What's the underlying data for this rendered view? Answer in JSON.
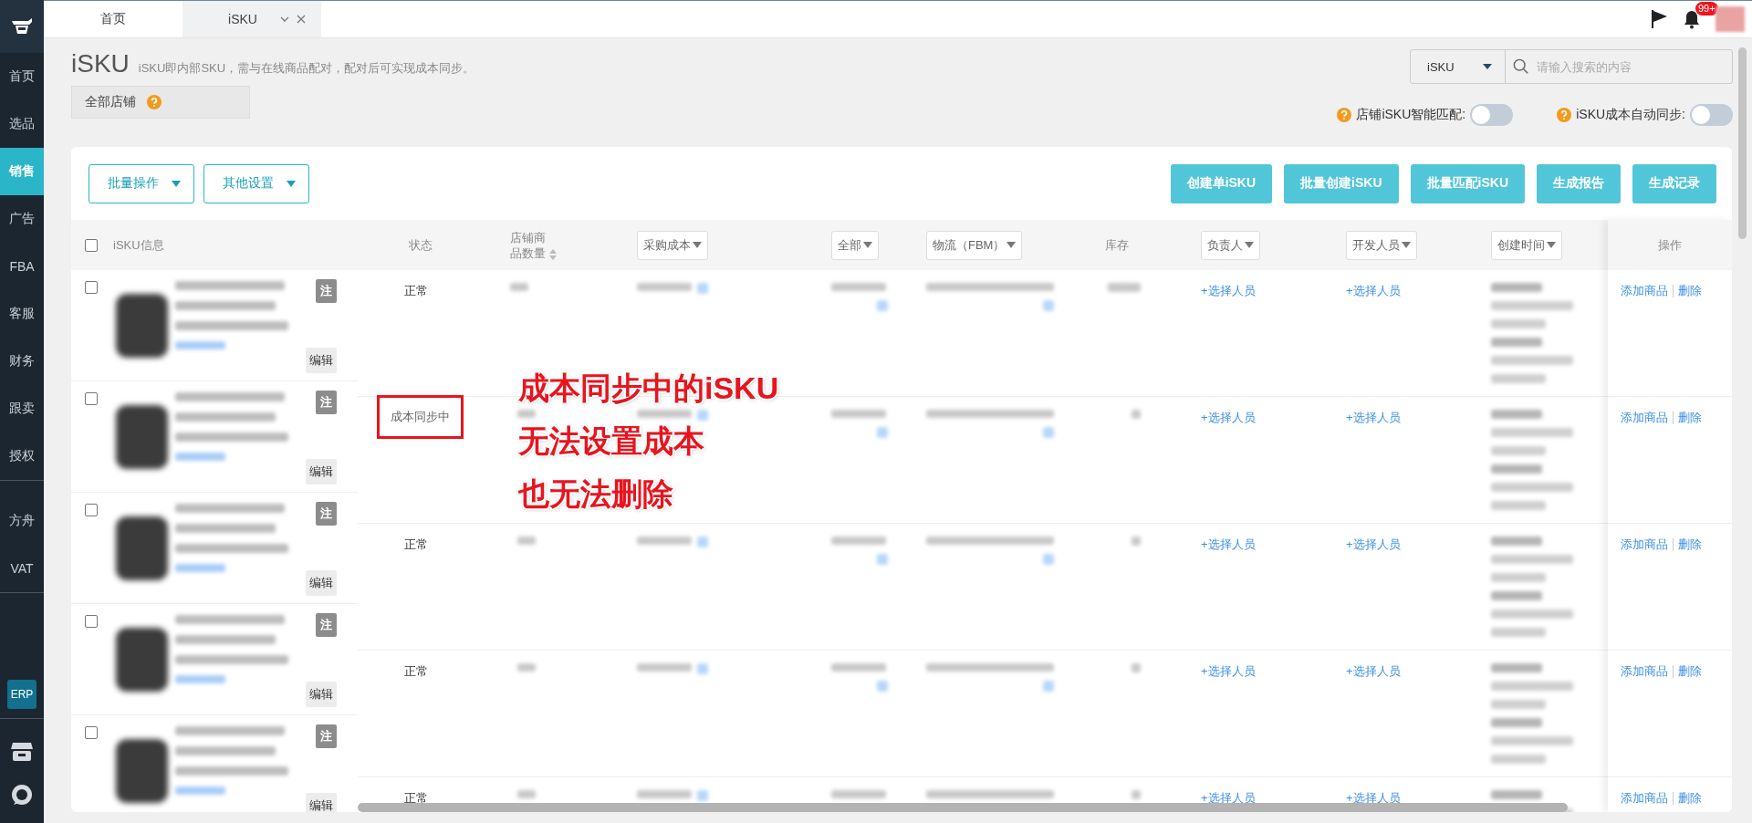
{
  "sidebar": {
    "groups": [
      {
        "items": [
          {
            "label": "首页",
            "kind": "nav",
            "selected": false
          },
          {
            "label": "选品",
            "kind": "nav",
            "selected": false
          },
          {
            "label": "销售",
            "kind": "nav",
            "selected": true
          },
          {
            "label": "广告",
            "kind": "nav",
            "selected": false
          },
          {
            "label": "FBA",
            "kind": "nav",
            "selected": false
          },
          {
            "label": "客服",
            "kind": "nav",
            "selected": false
          },
          {
            "label": "财务",
            "kind": "nav",
            "selected": false
          },
          {
            "label": "跟卖",
            "kind": "nav",
            "selected": false
          },
          {
            "label": "授权",
            "kind": "nav",
            "selected": false
          }
        ]
      },
      {
        "items": [
          {
            "label": "方舟",
            "kind": "nav",
            "selected": false
          },
          {
            "label": "VAT",
            "kind": "nav",
            "selected": false
          }
        ]
      },
      {
        "items": [
          {
            "label": "ERP",
            "kind": "badge",
            "selected": false
          }
        ]
      }
    ]
  },
  "tabs": [
    {
      "label": "首页",
      "selected": false,
      "closable": false
    },
    {
      "label": "iSKU",
      "selected": true,
      "closable": true
    }
  ],
  "topbar": {
    "notification_count": "99+"
  },
  "header": {
    "title": "iSKU",
    "description": "iSKU即内部SKU，需与在线商品配对，配对后可实现成本同步。",
    "store_filter": "全部店铺",
    "search": {
      "type": "iSKU",
      "placeholder": "请输入搜索的内容"
    },
    "toggles": [
      {
        "label": "店铺iSKU智能匹配:",
        "on": false
      },
      {
        "label": "iSKU成本自动同步:",
        "on": false
      }
    ]
  },
  "toolbar": {
    "dropdowns": [
      "批量操作",
      "其他设置"
    ],
    "buttons": [
      "创建单iSKU",
      "批量创建iSKU",
      "批量匹配iSKU",
      "生成报告",
      "生成记录"
    ]
  },
  "table": {
    "select_all_checked": false,
    "columns": [
      {
        "label": "iSKU信息",
        "kind": "plain"
      },
      {
        "label": "状态",
        "kind": "plain"
      },
      {
        "label": "店铺商品数量",
        "kind": "sort"
      },
      {
        "label": "采购成本",
        "kind": "filter"
      },
      {
        "label": "全部",
        "kind": "filter"
      },
      {
        "label": "物流（FBM）",
        "kind": "filter"
      },
      {
        "label": "库存",
        "kind": "plain"
      },
      {
        "label": "负责人",
        "kind": "filter"
      },
      {
        "label": "开发人员",
        "kind": "filter"
      },
      {
        "label": "创建时间",
        "kind": "filter"
      },
      {
        "label": "操作",
        "kind": "plain"
      }
    ],
    "rows": [
      {
        "checked": false,
        "note_tag": "注",
        "edit_button": "编辑",
        "status": "正常",
        "highlighted": false,
        "assignee": "+选择人员",
        "developer": "+选择人员",
        "actions": [
          "添加商品",
          "删除"
        ]
      },
      {
        "checked": false,
        "note_tag": "注",
        "edit_button": "编辑",
        "status": "成本同步中",
        "highlighted": true,
        "assignee": "+选择人员",
        "developer": "+选择人员",
        "actions": [
          "添加商品",
          "删除"
        ]
      },
      {
        "checked": false,
        "note_tag": "注",
        "edit_button": "编辑",
        "status": "正常",
        "highlighted": false,
        "assignee": "+选择人员",
        "developer": "+选择人员",
        "actions": [
          "添加商品",
          "删除"
        ]
      },
      {
        "checked": false,
        "note_tag": "注",
        "edit_button": "编辑",
        "status": "正常",
        "highlighted": false,
        "assignee": "+选择人员",
        "developer": "+选择人员",
        "actions": [
          "添加商品",
          "删除"
        ]
      },
      {
        "checked": false,
        "note_tag": "注",
        "edit_button": "编辑",
        "status": "正常",
        "highlighted": false,
        "assignee": "+选择人员",
        "developer": "+选择人员",
        "actions": [
          "添加商品",
          "删除"
        ]
      }
    ]
  },
  "annotation": {
    "lines": [
      "成本同步中的iSKU",
      "无法设置成本",
      "也无法删除"
    ]
  }
}
